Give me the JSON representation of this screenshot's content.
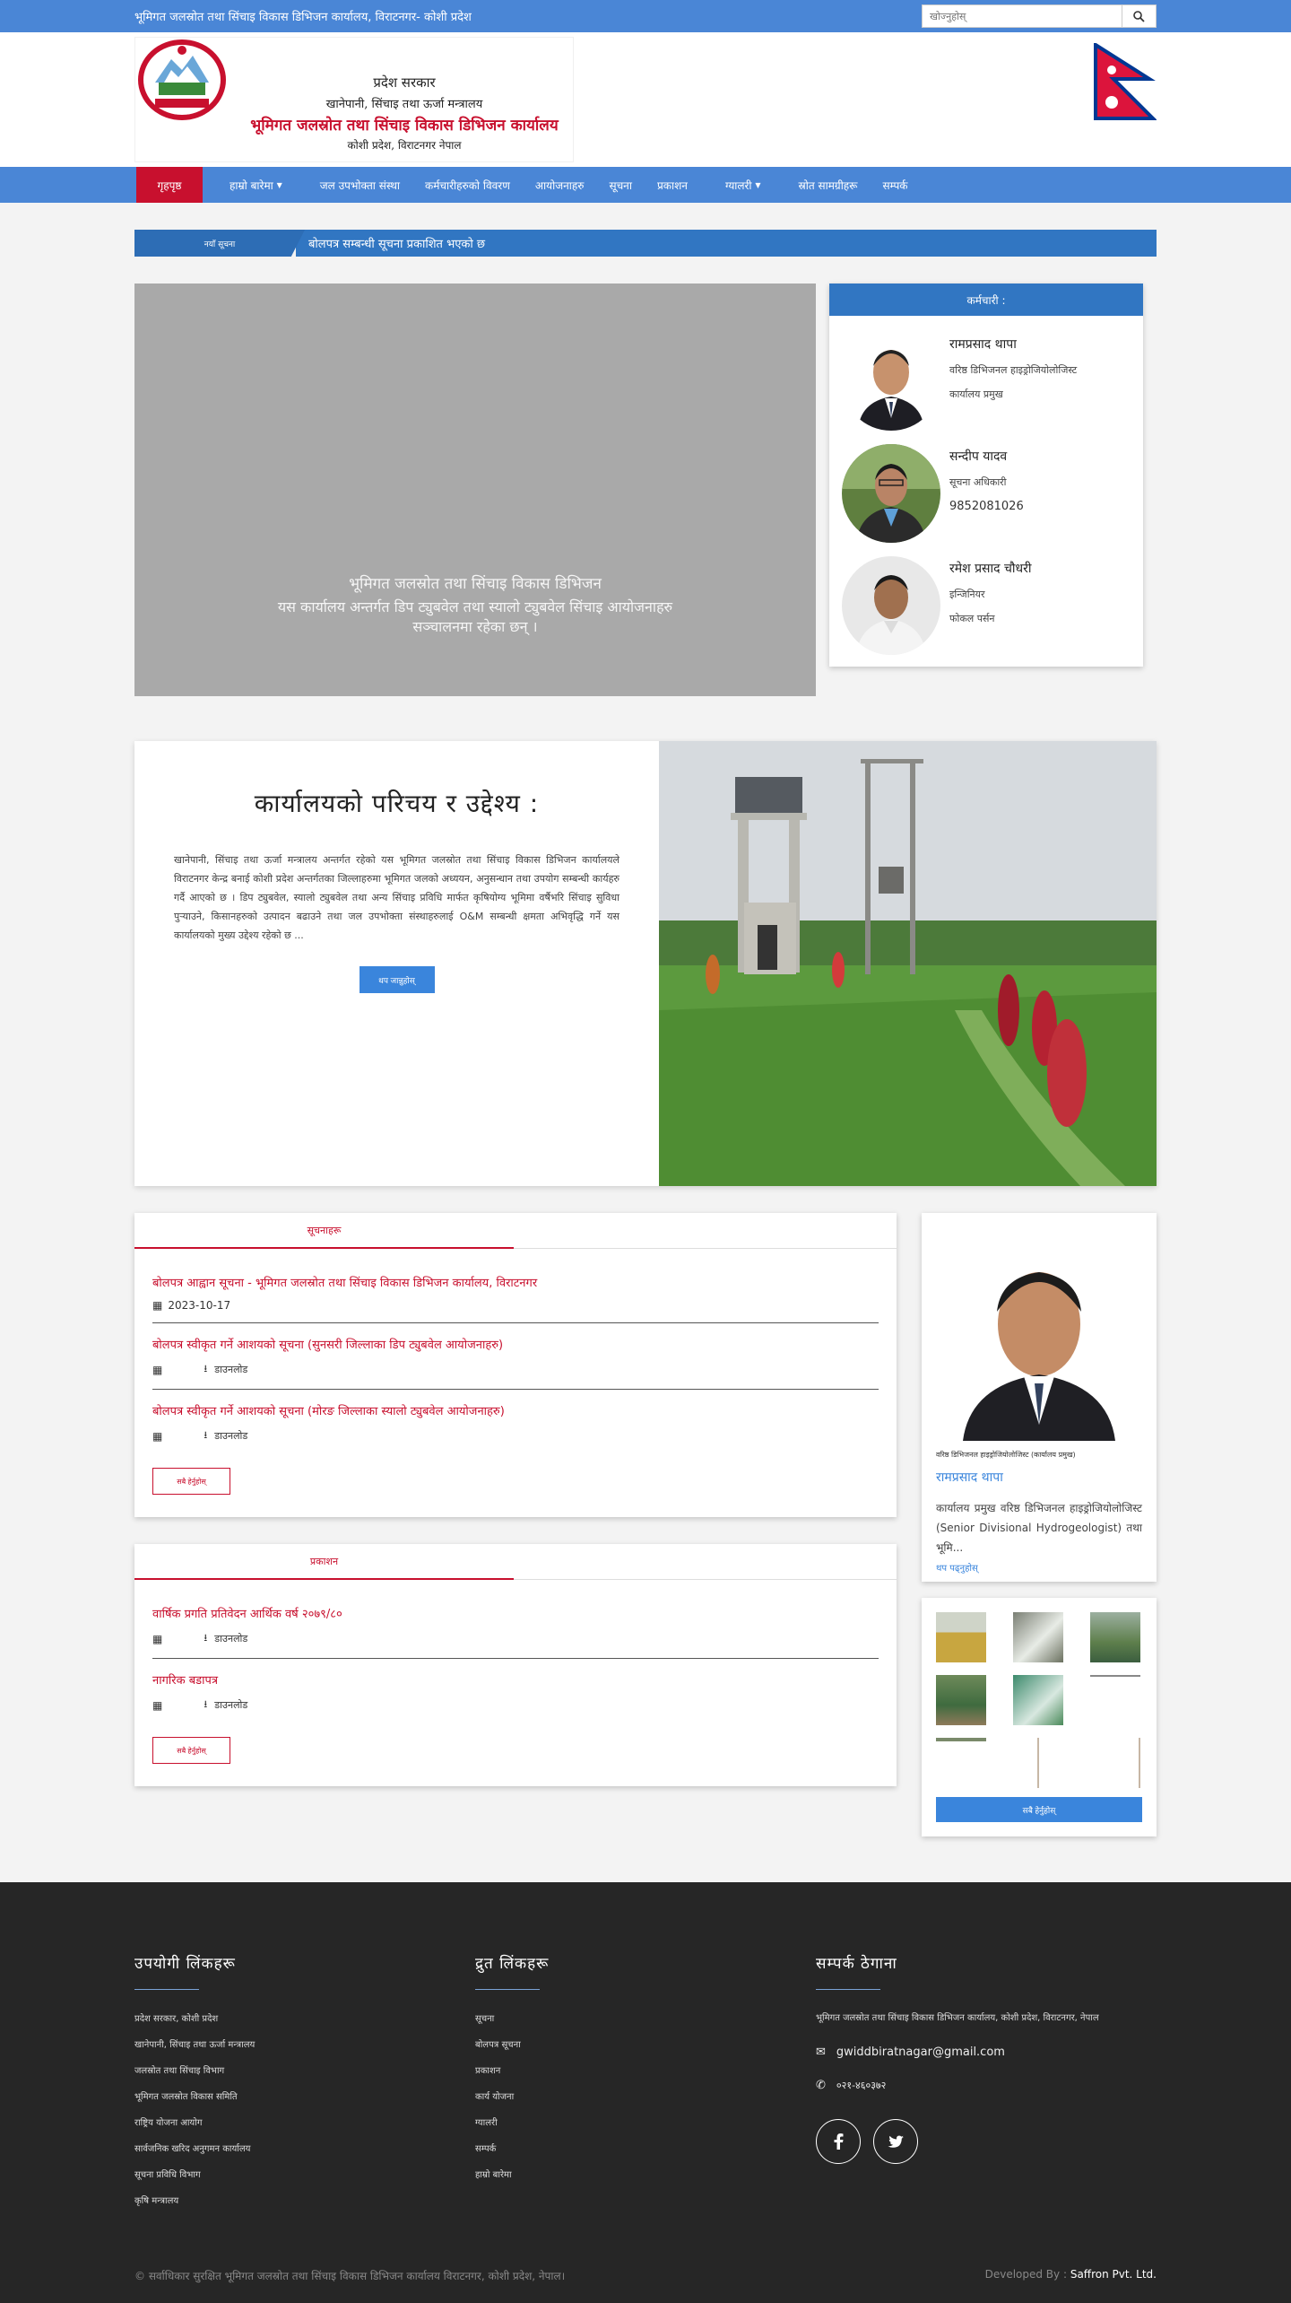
{
  "topbar": {
    "marquee": "भूमिगत जलस्रोत तथा सिंचाइ विकास डिभिजन कार्यालय, विराटनगर- कोशी प्रदेश",
    "search_placeholder": "खोज्नुहोस्"
  },
  "header": {
    "line1": "प्रदेश सरकार",
    "line2": "खानेपानी, सिंचाइ तथा ऊर्जा मन्त्रालय",
    "line3": "भूमिगत जलस्रोत तथा सिंचाइ विकास डिभिजन कार्यालय",
    "line4": "कोशी प्रदेश, विराटनगर नेपाल"
  },
  "nav": {
    "items": [
      "गृहपृष्ठ",
      "हाम्रो बारेमा",
      "जल उपभोक्ता संस्था",
      "कर्मचारीहरुको विवरण",
      "आयोजनाहरु",
      "सूचना",
      "प्रकाशन",
      "स्रोत सामग्रीहरू",
      "ग्यालरी",
      "सम्पर्क"
    ],
    "dropdowns": [
      "हाम्रो बारेमा",
      "ग्यालरी"
    ]
  },
  "ticker": {
    "label": "नयाँ सूचना",
    "text": "बोलपत्र सम्बन्धी सूचना प्रकाशित भएको छ"
  },
  "slider": {
    "caption_title": "भूमिगत जलस्रोत तथा सिंचाइ विकास डिभिजन",
    "caption_text": "यस कार्यालय अन्तर्गत डिप ट्युबवेल तथा स्यालो ट्युबवेल सिंचाइ आयोजनाहरु सञ्चालनमा रहेका छन् ।"
  },
  "staff": {
    "heading": "कर्मचारी :",
    "people": [
      {
        "name": "रामप्रसाद थापा",
        "role": "वरिष्ठ डिभिजनल हाइड्रोजियोलोजिस्ट",
        "phone": "कार्यालय प्रमुख"
      },
      {
        "name": "सन्दीप यादव",
        "role": "सूचना अधिकारी",
        "phone": "9852081026"
      },
      {
        "name": "रमेश प्रसाद चौधरी",
        "role": "इन्जिनियर",
        "phone": "फोकल पर्सन"
      }
    ]
  },
  "about": {
    "heading": "कार्यालयको परिचय र उद्देश्य :",
    "body": "खानेपानी, सिंचाइ तथा ऊर्जा मन्त्रालय अन्तर्गत रहेको यस भूमिगत जलस्रोत तथा सिंचाइ विकास डिभिजन कार्यालयले विराटनगर केन्द्र बनाई कोशी प्रदेश अन्तर्गतका जिल्लाहरुमा भूमिगत जलको अध्ययन, अनुसन्धान तथा उपयोग सम्बन्धी कार्यहरु गर्दै आएको छ । डिप ट्युबवेल, स्यालो ट्युबवेल तथा अन्य सिंचाइ प्रविधि मार्फत कृषियोग्य भूमिमा वर्षैभरि सिंचाइ सुविधा पुर्‍याउने, किसानहरुको उत्पादन बढाउने तथा जल उपभोक्ता संस्थाहरुलाई O&M सम्बन्धी क्षमता अभिवृद्धि गर्ने यस कार्यालयको मुख्य उद्देश्य रहेको छ ...",
    "button": "थप जान्नुहोस्"
  },
  "notices": {
    "tab": "सूचनाहरू",
    "items": [
      {
        "title": "बोलपत्र आह्वान सूचना - भूमिगत जलस्रोत तथा सिंचाइ विकास डिभिजन कार्यालय, विराटनगर",
        "date": "2023-10-17",
        "download": ""
      },
      {
        "title": "बोलपत्र स्वीकृत गर्ने आशयको सूचना (सुनसरी जिल्लाका डिप ट्युबवेल आयोजनाहरु)",
        "date": "",
        "download": "डाउनलोड"
      },
      {
        "title": "बोलपत्र स्वीकृत गर्ने आशयको सूचना (मोरङ जिल्लाका स्यालो ट्युबवेल आयोजनाहरु)",
        "date": "",
        "download": "डाउनलोड"
      }
    ],
    "more": "सबै हेर्नुहोस्"
  },
  "publications": {
    "tab": "प्रकाशन",
    "items": [
      {
        "title": "वार्षिक प्रगति प्रतिवेदन आर्थिक वर्ष २०७९/८०",
        "download": "डाउनलोड"
      },
      {
        "title": "नागरिक बडापत्र",
        "download": "डाउनलोड"
      }
    ],
    "more": "सबै हेर्नुहोस्"
  },
  "chief": {
    "designation": "वरिष्ठ डिभिजनल हाइड्रोजियोलोजिस्ट (कार्यालय प्रमुख)",
    "name": "रामप्रसाद थापा",
    "bio": "कार्यालय प्रमुख वरिष्ठ डिभिजनल हाइड्रोजियोलोजिस्ट (Senior Divisional Hydrogeologist) तथा भूमि...",
    "more": "थप पढ्नुहोस्"
  },
  "gallery": {
    "button": "सबै हेर्नुहोस्"
  },
  "footer": {
    "col1_title": "उपयोगी लिंकहरू",
    "col1_items": [
      "प्रदेश सरकार, कोशी प्रदेश",
      "खानेपानी, सिंचाइ तथा ऊर्जा मन्त्रालय",
      "जलस्रोत तथा सिंचाइ विभाग",
      "भूमिगत जलस्रोत विकास समिति",
      "राष्ट्रिय योजना आयोग",
      "सार्वजनिक खरिद अनुगमन कार्यालय",
      "सूचना प्रविधि विभाग",
      "कृषि मन्त्रालय"
    ],
    "col2_title": "द्रुत लिंकहरू",
    "col2_items": [
      "सूचना",
      "बोलपत्र सूचना",
      "प्रकाशन",
      "कार्य योजना",
      "ग्यालरी",
      "सम्पर्क",
      "हाम्रो बारेमा"
    ],
    "col3_title": "सम्पर्क ठेगाना",
    "address": "भूमिगत जलस्रोत तथा सिंचाइ विकास डिभिजन कार्यालय, कोशी प्रदेश, विराटनगर, नेपाल",
    "email": "gwiddbiratnagar@gmail.com",
    "phone": "०२१-४६०३७२",
    "copyright": "© सर्वाधिकार सुरक्षित भूमिगत जलस्रोत तथा सिंचाइ विकास डिभिजन कार्यालय विराटनगर, कोशी प्रदेश, नेपाल।",
    "developed_label": "Developed By :",
    "developer": "Saffron Pvt. Ltd."
  },
  "colors": {
    "primary": "#4a86d6",
    "accent": "#c8102e",
    "footer": "#262626"
  }
}
